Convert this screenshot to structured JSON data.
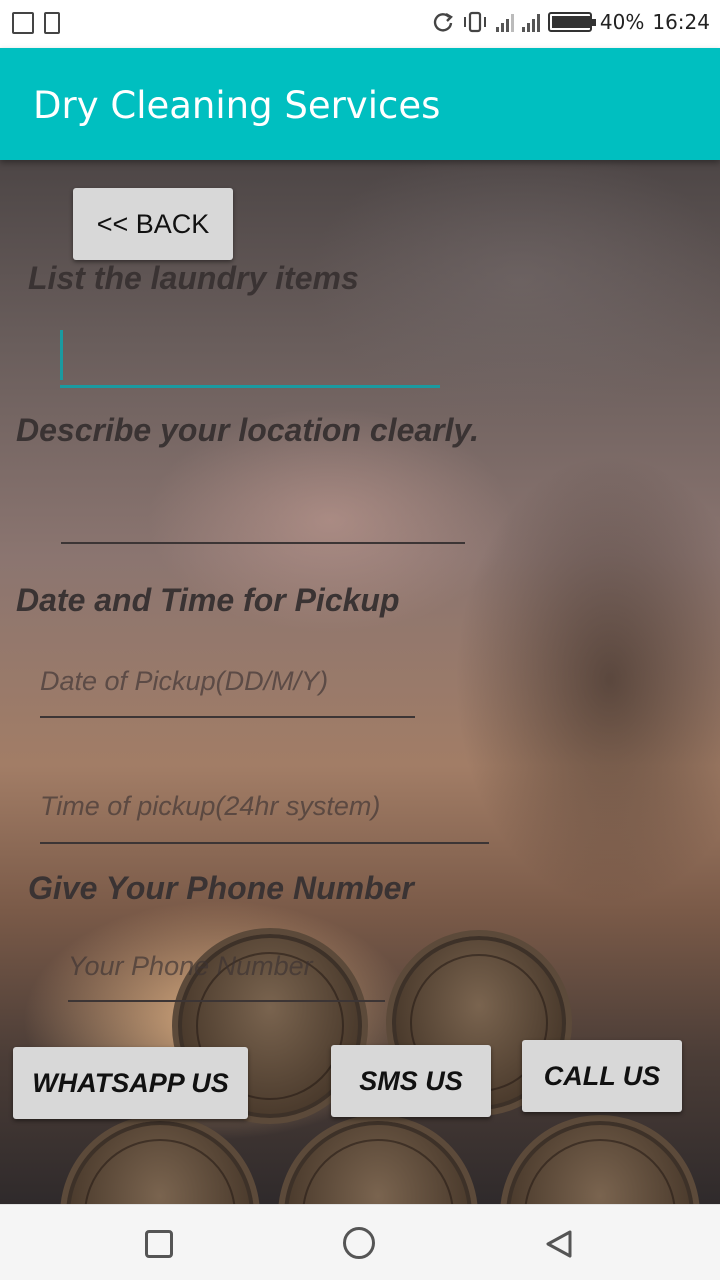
{
  "status_bar": {
    "battery": "40%",
    "battery_level": 0.4,
    "time": "16:24"
  },
  "app_bar": {
    "title": "Dry Cleaning Services"
  },
  "form": {
    "back_button": "<< BACK",
    "laundry_label": "List the laundry items",
    "laundry_value": "",
    "location_label": "Describe your location clearly.",
    "location_value": "",
    "pickup_label": "Date and Time for Pickup",
    "date_placeholder": "Date of Pickup(DD/M/Y)",
    "time_placeholder": "Time of pickup(24hr system)",
    "phone_label": "Give Your Phone Number",
    "phone_placeholder": "Your Phone Number"
  },
  "actions": {
    "whatsapp": "WHATSAPP US",
    "sms": "SMS US",
    "call": "CALL US"
  },
  "colors": {
    "accent": "#00bfc0",
    "button": "#d8d8d8"
  }
}
